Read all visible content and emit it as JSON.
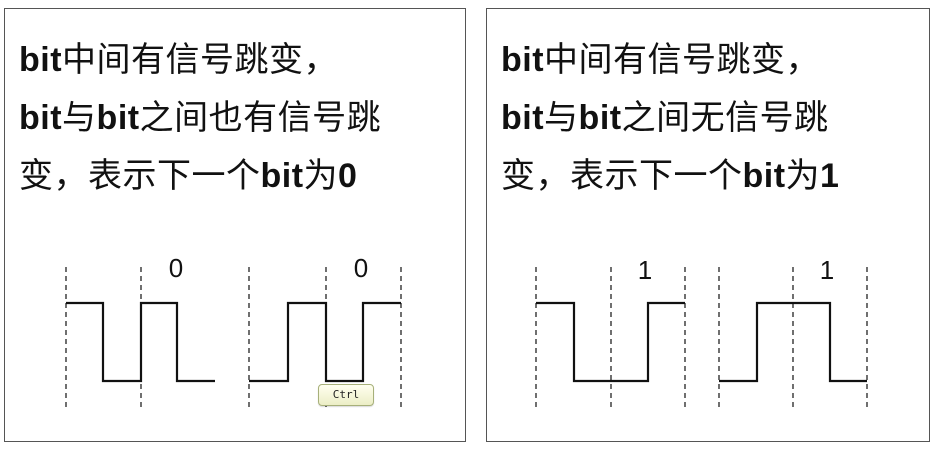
{
  "left_panel": {
    "line1": {
      "bit": "bit",
      "text": "中间有信号跳变，"
    },
    "line2": {
      "bit_a": "bit",
      "text_a": "与",
      "bit_b": "bit",
      "text_b": "之间也有信号跳"
    },
    "line3": {
      "text_a": "变，表示下一个",
      "bit": "bit",
      "text_b": "为",
      "value": "0"
    },
    "bit_labels": [
      "0",
      "0"
    ]
  },
  "right_panel": {
    "line1": {
      "bit": "bit",
      "text": "中间有信号跳变，"
    },
    "line2": {
      "bit_a": "bit",
      "text_a": "与",
      "bit_b": "bit",
      "text_b": "之间无信号跳"
    },
    "line3": {
      "text_a": "变，表示下一个",
      "bit": "bit",
      "text_b": "为",
      "value": "1"
    },
    "bit_labels": [
      "1",
      "1"
    ]
  },
  "overlay": {
    "ctrl_key_label": "Ctrl"
  }
}
